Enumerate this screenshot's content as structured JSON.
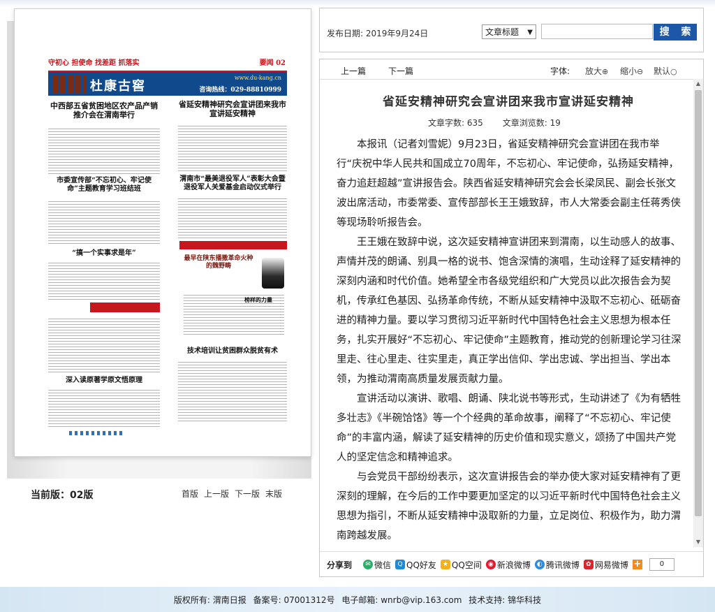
{
  "search": {
    "pubdate": "发布日期: 2019年9月24日",
    "field_select": "文章标题",
    "input_value": "",
    "button": "搜 索"
  },
  "toolbar": {
    "prev": "上一篇",
    "next": "下一篇",
    "font_label": "字体:",
    "zoom_in": "放大",
    "zoom_out": "缩小",
    "zoom_default": "默认"
  },
  "article": {
    "title": "省延安精神研究会宣讲团来我市宣讲延安精神",
    "word_count": "文章字数: 635",
    "views": "文章浏览数: 19",
    "paragraphs": [
      "本报讯（记者刘雪妮）9月23日，省延安精神研究会宣讲团在我市举行“庆祝中华人民共和国成立70周年，不忘初心、牢记使命，弘扬延安精神，奋力追赶超越”宣讲报告会。陕西省延安精神研究会会长梁凤民、副会长张文波出席活动，市委常委、宣传部部长王王娥致辞，市人大常委会副主任蒋秀侠等现场聆听报告会。",
      "王王娥在致辞中说，这次延安精神宣讲团来到渭南，以生动感人的故事、声情并茂的朗诵、别具一格的说书、饱含深情的演唱，生动诠释了延安精神的深刻内涵和时代价值。她希望全市各级党组织和广大党员以此次报告会为契机，传承红色基因、弘扬革命传统，不断从延安精神中汲取不忘初心、砥砺奋进的精神力量。要以学习贯彻习近平新时代中国特色社会主义思想为根本任务，扎实开展好“不忘初心、牢记使命”主题教育，推动党的创新理论学习往深里走、往心里走、往实里走，真正学出信仰、学出忠诚、学出担当、学出本领，为推动渭南高质量发展贡献力量。",
      "宣讲活动以演讲、歌唱、朗诵、陕北说书等形式，生动讲述了《为有牺牲多壮志》《半碗饸饹》等一个个经典的革命故事，阐释了“不忘初心、牢记使命”的丰富内涵，解读了延安精神的历史价值和现实意义，颂扬了中国共产党人的坚定信念和精神追求。",
      "与会党员干部纷纷表示，这次宣讲报告会的举办使大家对延安精神有了更深刻的理解，在今后的工作中要更加坚定的以习近平新时代中国特色社会主义思想为指引，不断从延安精神中汲取新的力量，立足岗位、积极作为，助力渭南跨越发展。"
    ]
  },
  "share": {
    "label": "分享到",
    "items": [
      "微信",
      "QQ好友",
      "QQ空间",
      "新浪微博",
      "腾讯微博",
      "网易微博"
    ],
    "count": "0"
  },
  "page_nav": {
    "current": "当前版：02版",
    "first": "首版",
    "prev": "上一版",
    "next": "下一版",
    "last": "末版"
  },
  "newspaper": {
    "slogan": "守初心 担使命 找差距 抓落实",
    "edition": "要闻 02",
    "ad_name": "杜康古窖",
    "ad_url": "www.du-kang.cn",
    "ad_tel": "咨询热线：029-88810999",
    "headlines": [
      "中西部五省贫困地区农产品产销推介会在渭南举行",
      "省延安精神研究会宣讲团来我市宣讲延安精神",
      "市委宣传部“不忘初心、牢记使命”主题教育学习班结班",
      "渭南市“最美退役军人”表彰大会暨退役军人关爱基金启动仪式举行",
      "“搞一个实事求是年”",
      "最早在陕东播撒革命火种的魏野畴",
      "榜样的力量",
      "技术培训让贫困群众脱贫有术",
      "深入读原著学原文悟原理"
    ]
  },
  "footer": {
    "copyright": "版权所有: 渭南日报",
    "icp": "备案号: 07001312号",
    "email": "电子邮箱: wnrb@vip.163.com",
    "support": "技术支持: 锦华科技"
  }
}
